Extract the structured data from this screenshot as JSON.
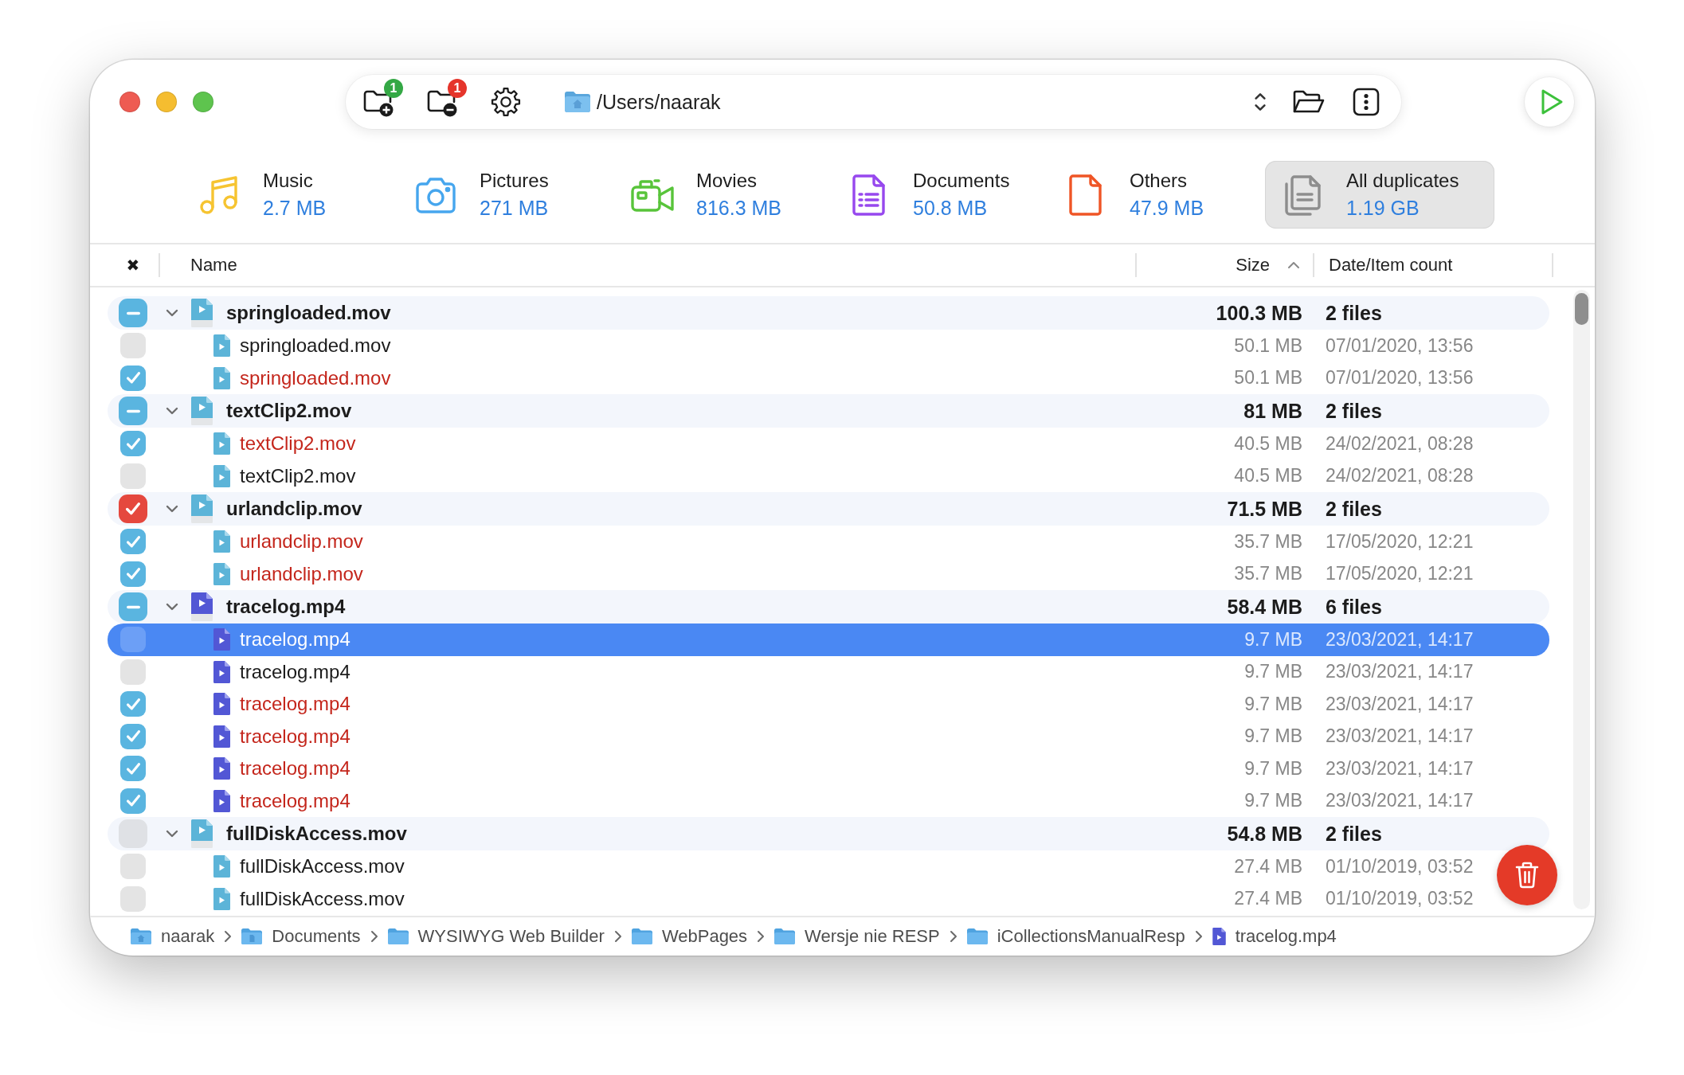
{
  "toolbar": {
    "buttons": [
      {
        "kind": "add-folder",
        "badge": "1"
      },
      {
        "kind": "remove-folder",
        "badge": "1"
      },
      {
        "kind": "settings"
      }
    ],
    "path": "/Users/naarak"
  },
  "categories": [
    {
      "kind": "music",
      "label": "Music",
      "size": "2.7 MB",
      "selected": false
    },
    {
      "kind": "pictures",
      "label": "Pictures",
      "size": "271 MB",
      "selected": false
    },
    {
      "kind": "movies",
      "label": "Movies",
      "size": "816.3 MB",
      "selected": false
    },
    {
      "kind": "documents",
      "label": "Documents",
      "size": "50.8 MB",
      "selected": false
    },
    {
      "kind": "others",
      "label": "Others",
      "size": "47.9 MB",
      "selected": false
    },
    {
      "kind": "all",
      "label": "All duplicates",
      "size": "1.19 GB",
      "selected": true
    }
  ],
  "table": {
    "columns": [
      {
        "label": "✖",
        "sorted": false
      },
      {
        "label": "Name",
        "sorted": false
      },
      {
        "label": "Size",
        "sorted": true
      },
      {
        "label": "Date/Item count",
        "sorted": false
      }
    ],
    "groups": [
      {
        "kind": "mov",
        "name": "springloaded.mov",
        "size": "100.3 MB",
        "count": "2 files",
        "expanded": true,
        "selected": false,
        "children": [
          {
            "name": "springloaded.mov",
            "size": "50.1 MB",
            "date": "07/01/2020, 13:56",
            "checked": false,
            "selected": false
          },
          {
            "name": "springloaded.mov",
            "size": "50.1 MB",
            "date": "07/01/2020, 13:56",
            "checked": true,
            "selected": false
          }
        ]
      },
      {
        "kind": "mov",
        "name": "textClip2.mov",
        "size": "81 MB",
        "count": "2 files",
        "expanded": true,
        "selected": false,
        "children": [
          {
            "name": "textClip2.mov",
            "size": "40.5 MB",
            "date": "24/02/2021, 08:28",
            "checked": true,
            "selected": false
          },
          {
            "name": "textClip2.mov",
            "size": "40.5 MB",
            "date": "24/02/2021, 08:28",
            "checked": false,
            "selected": false
          }
        ]
      },
      {
        "kind": "mov",
        "name": "urlandclip.mov",
        "size": "71.5 MB",
        "count": "2 files",
        "expanded": true,
        "selected": false,
        "children": [
          {
            "name": "urlandclip.mov",
            "size": "35.7 MB",
            "date": "17/05/2020, 12:21",
            "checked": true,
            "selected": false
          },
          {
            "name": "urlandclip.mov",
            "size": "35.7 MB",
            "date": "17/05/2020, 12:21",
            "checked": true,
            "selected": false
          }
        ]
      },
      {
        "kind": "mp4",
        "name": "tracelog.mp4",
        "size": "58.4 MB",
        "count": "6 files",
        "expanded": true,
        "selected": false,
        "children": [
          {
            "name": "tracelog.mp4",
            "size": "9.7 MB",
            "date": "23/03/2021, 14:17",
            "checked": false,
            "selected": true
          },
          {
            "name": "tracelog.mp4",
            "size": "9.7 MB",
            "date": "23/03/2021, 14:17",
            "checked": false,
            "selected": false
          },
          {
            "name": "tracelog.mp4",
            "size": "9.7 MB",
            "date": "23/03/2021, 14:17",
            "checked": true,
            "selected": false
          },
          {
            "name": "tracelog.mp4",
            "size": "9.7 MB",
            "date": "23/03/2021, 14:17",
            "checked": true,
            "selected": false
          },
          {
            "name": "tracelog.mp4",
            "size": "9.7 MB",
            "date": "23/03/2021, 14:17",
            "checked": true,
            "selected": false
          },
          {
            "name": "tracelog.mp4",
            "size": "9.7 MB",
            "date": "23/03/2021, 14:17",
            "checked": true,
            "selected": false
          }
        ]
      },
      {
        "kind": "mov",
        "name": "fullDiskAccess.mov",
        "size": "54.8 MB",
        "count": "2 files",
        "expanded": true,
        "selected": false,
        "children": [
          {
            "name": "fullDiskAccess.mov",
            "size": "27.4 MB",
            "date": "01/10/2019, 03:52",
            "checked": false,
            "selected": false
          },
          {
            "name": "fullDiskAccess.mov",
            "size": "27.4 MB",
            "date": "01/10/2019, 03:52",
            "checked": false,
            "selected": false
          }
        ]
      }
    ]
  },
  "breadcrumb": [
    {
      "kind": "home",
      "label": "naarak"
    },
    {
      "kind": "documents",
      "label": "Documents"
    },
    {
      "kind": "folder",
      "label": "WYSIWYG Web Builder"
    },
    {
      "kind": "folder",
      "label": "WebPages"
    },
    {
      "kind": "folder",
      "label": "Wersje nie RESP"
    },
    {
      "kind": "folder",
      "label": "iCollectionsManualResp"
    },
    {
      "kind": "mp4",
      "label": "tracelog.mp4"
    }
  ]
}
